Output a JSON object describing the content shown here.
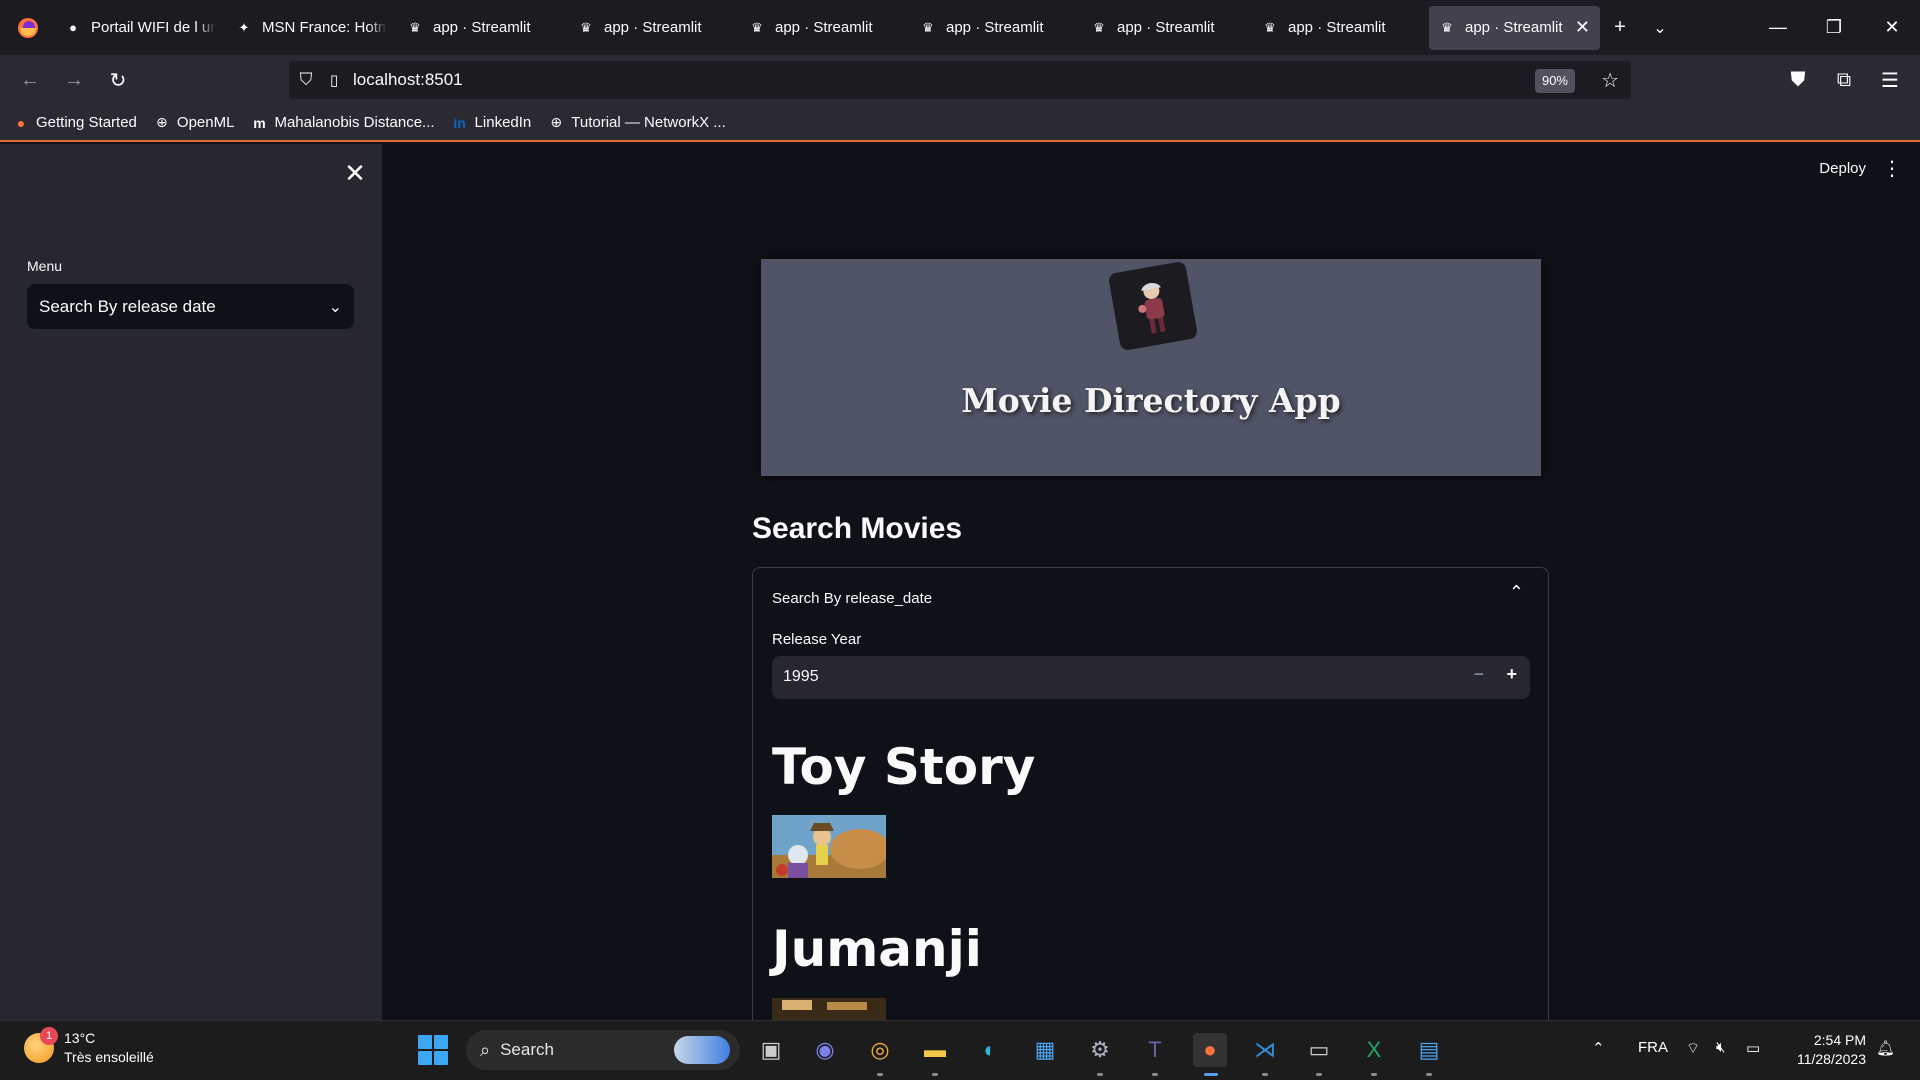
{
  "browser": {
    "tabs": [
      {
        "label": "Portail WIFI de l universite",
        "icon": "globe-icon"
      },
      {
        "label": "MSN France: Hotmail",
        "icon": "msn-icon"
      },
      {
        "label": "app · Streamlit",
        "icon": "streamlit-icon"
      },
      {
        "label": "app · Streamlit",
        "icon": "streamlit-icon"
      },
      {
        "label": "app · Streamlit",
        "icon": "streamlit-icon"
      },
      {
        "label": "app · Streamlit",
        "icon": "streamlit-icon"
      },
      {
        "label": "app · Streamlit",
        "icon": "streamlit-icon"
      },
      {
        "label": "app · Streamlit",
        "icon": "streamlit-icon"
      },
      {
        "label": "app · Streamlit",
        "icon": "streamlit-icon",
        "active": true
      }
    ],
    "url": "localhost:8501",
    "zoom": "90%",
    "bookmarks": [
      {
        "label": "Getting Started",
        "icon": "firefox-icon"
      },
      {
        "label": "OpenML",
        "icon": "globe-icon"
      },
      {
        "label": "Mahalanobis Distance...",
        "icon": "medium-icon"
      },
      {
        "label": "LinkedIn",
        "icon": "linkedin-icon"
      },
      {
        "label": "Tutorial — NetworkX ...",
        "icon": "globe-icon"
      }
    ]
  },
  "sidebar": {
    "menu_label": "Menu",
    "menu_value": "Search By release date"
  },
  "header": {
    "deploy_label": "Deploy"
  },
  "app": {
    "title": "Movie Directory App",
    "section_title": "Search Movies",
    "expander_title": "Search By release_date",
    "release_year_label": "Release Year",
    "release_year_value": "1995",
    "movies": [
      {
        "title": "Toy Story"
      },
      {
        "title": "Jumanji"
      }
    ]
  },
  "taskbar": {
    "weather_temp": "13°C",
    "weather_desc": "Très ensoleillé",
    "weather_badge": "1",
    "search_label": "Search",
    "language": "FRA",
    "time": "2:54 PM",
    "date": "11/28/2023"
  },
  "colors": {
    "streamlit_bg": "#0e1117",
    "sidebar_bg": "#262730",
    "hero_bg": "#4f5467",
    "accent": "#e66b3a"
  }
}
